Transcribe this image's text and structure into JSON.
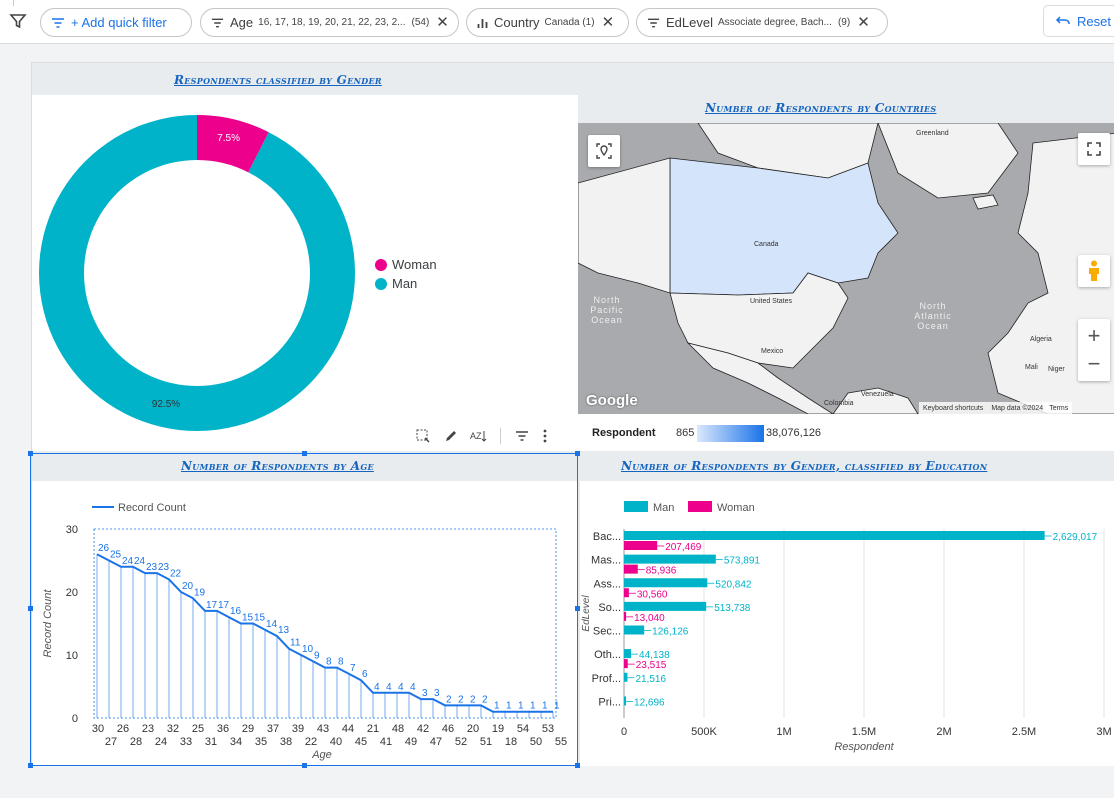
{
  "filterbar": {
    "quick_filter_label": "+ Add quick filter",
    "chips": [
      {
        "label": "Age",
        "value": "16, 17, 18, 19, 20, 21, 22, 23, 2...",
        "count": "(54)"
      },
      {
        "label": "Country",
        "value": "Canada (1)",
        "count": ""
      },
      {
        "label": "EdLevel",
        "value": "Associate degree, Bach...",
        "count": "(9)"
      }
    ],
    "reset_label": "Reset"
  },
  "gender_chart": {
    "title": "Respondents classified by Gender",
    "legend": [
      "Woman",
      "Man"
    ]
  },
  "map_chart": {
    "title": "Number of Respondents by Countries",
    "labels": {
      "greenland": "Greenland",
      "canada": "Canada",
      "us": "United States",
      "mexico": "Mexico",
      "colombia": "Colombia",
      "venezuela": "Venezuela",
      "algeria": "Algeria",
      "mali": "Mali",
      "niger": "Niger",
      "north_pacific": "North Pacific Ocean",
      "north_atlantic": "North Atlantic Ocean",
      "google": "Google",
      "shortcuts": "Keyboard shortcuts",
      "map_data": "Map data ©2024",
      "terms": "Terms"
    },
    "scale_label": "Respondent",
    "scale_min": "865",
    "scale_max": "38,076,126"
  },
  "age_chart": {
    "title": "Number of Respondents by Age",
    "legend": "Record Count"
  },
  "edu_chart": {
    "title": "Number of Respondents by Gender, classified by Education",
    "legend": [
      "Man",
      "Woman"
    ]
  },
  "colors": {
    "man": "#00b3c8",
    "woman": "#ec008c",
    "line": "#1a73e8",
    "title": "#1565c0"
  },
  "chart_data": [
    {
      "type": "pie",
      "title": "Respondents classified by Gender",
      "categories": [
        "Woman",
        "Man"
      ],
      "values": [
        7.5,
        92.5
      ],
      "value_labels": [
        "7.5%",
        "92.5%"
      ],
      "legend": "right"
    },
    {
      "type": "line",
      "title": "Number of Respondents by Age",
      "xlabel": "Age",
      "ylabel": "Record Count",
      "ylim": [
        0,
        30
      ],
      "y_ticks": [
        0,
        10,
        20,
        30
      ],
      "series": [
        {
          "name": "Record Count",
          "x": [
            "30",
            "27",
            "26",
            "28",
            "23",
            "24",
            "32",
            "33",
            "25",
            "31",
            "36",
            "34",
            "29",
            "35",
            "37",
            "38",
            "39",
            "22",
            "43",
            "40",
            "44",
            "45",
            "21",
            "41",
            "48",
            "49",
            "42",
            "47",
            "46",
            "52",
            "18",
            "51",
            "20",
            "18",
            "19",
            "50",
            "54",
            "53",
            "55"
          ],
          "values": [
            26,
            25,
            24,
            24,
            23,
            23,
            22,
            20,
            19,
            17,
            17,
            16,
            15,
            15,
            14,
            13,
            11,
            10,
            9,
            8,
            8,
            7,
            6,
            4,
            4,
            4,
            4,
            3,
            3,
            2,
            2,
            2,
            2,
            1,
            1,
            1,
            1,
            1,
            1
          ]
        }
      ],
      "x_tick_labels_top": [
        "30",
        "26",
        "23",
        "32",
        "25",
        "36",
        "29",
        "37",
        "39",
        "43",
        "44",
        "21",
        "48",
        "42",
        "46",
        "20",
        "19",
        "54",
        "53"
      ],
      "x_tick_labels_bottom": [
        "27",
        "28",
        "24",
        "33",
        "31",
        "34",
        "35",
        "38",
        "22",
        "40",
        "45",
        "41",
        "49",
        "47",
        "52",
        "51",
        "18",
        "50",
        "55"
      ],
      "grid": false,
      "legend": "top-left"
    },
    {
      "type": "bar",
      "title": "Number of Respondents by Gender, classified by Education",
      "orientation": "horizontal",
      "categories": [
        "Bac...",
        "Mas...",
        "Ass...",
        "So...",
        "Sec...",
        "Oth...",
        "Prof...",
        "Pri..."
      ],
      "series": [
        {
          "name": "Man",
          "values": [
            2629017,
            573891,
            520842,
            513738,
            126126,
            44138,
            21516,
            12696
          ],
          "labels": [
            "2,629,017",
            "573,891",
            "520,842",
            "513,738",
            "126,126",
            "44,138",
            "21,516",
            "12,696"
          ]
        },
        {
          "name": "Woman",
          "values": [
            207469,
            85936,
            30560,
            13040,
            null,
            23515,
            null,
            null
          ],
          "labels": [
            "207,469",
            "85,936",
            "30,560",
            "13,040",
            "",
            "23,515",
            "",
            ""
          ]
        }
      ],
      "x_ticks": [
        "0",
        "500K",
        "1M",
        "1.5M",
        "2M",
        "2.5M",
        "3M"
      ],
      "xlim": [
        0,
        3000000
      ],
      "xlabel": "Respondent",
      "ylabel": "EdLevel",
      "grid": true,
      "legend": "top-left"
    }
  ]
}
